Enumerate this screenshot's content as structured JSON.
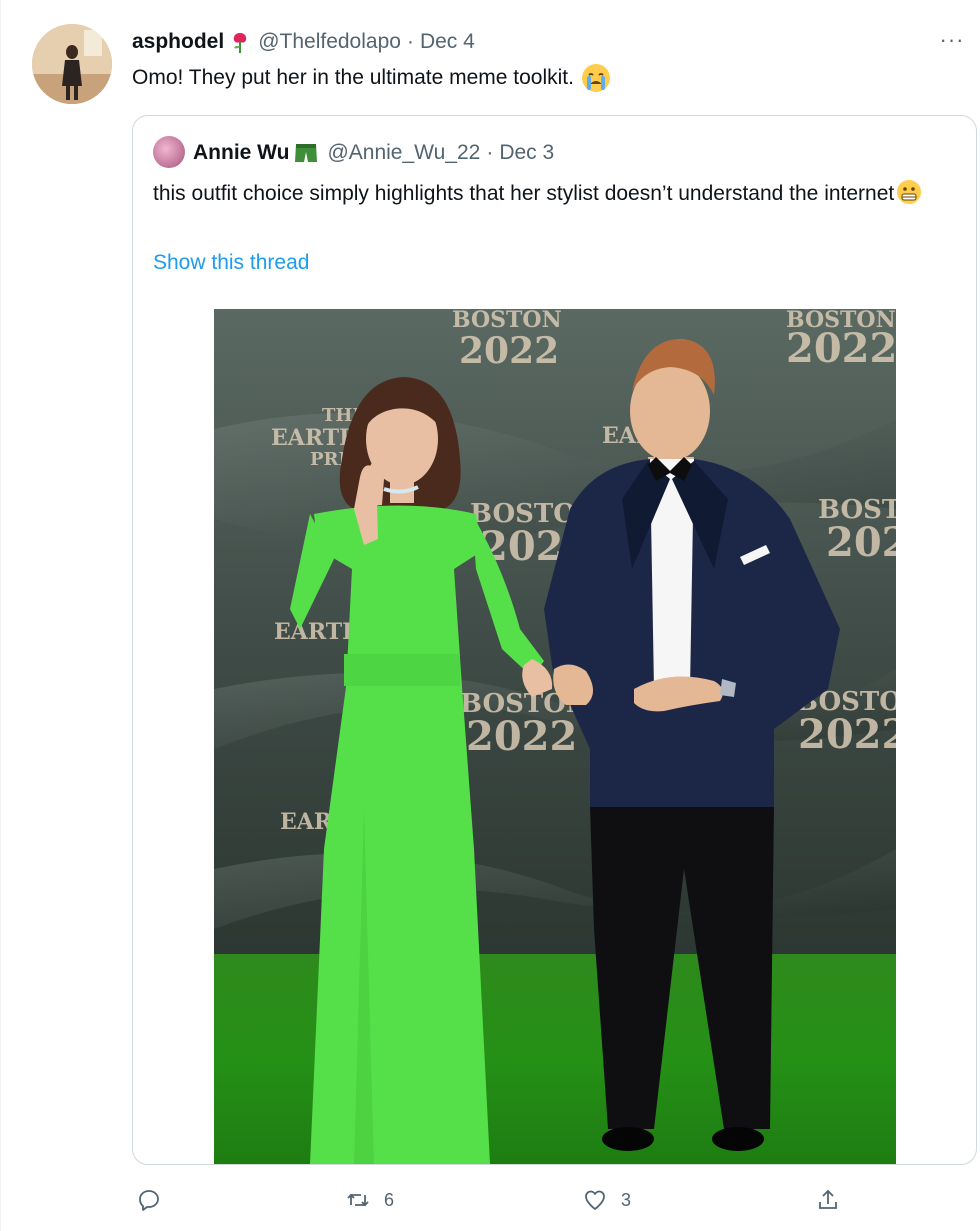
{
  "tweet": {
    "display_name": "asphodel",
    "handle": "@Thelfedolapo",
    "date": "Dec 4",
    "text": "Omo! They put her in the ultimate meme toolkit.",
    "more_label": "···"
  },
  "quoted": {
    "display_name": "Annie Wu",
    "handle": "@Annie_Wu_22",
    "date": "Dec 3",
    "text": "this outfit choice simply highlights that her stylist doesn’t understand the internet",
    "show_thread": "Show this thread"
  },
  "photo": {
    "backdrop": {
      "city": "BOSTON",
      "year": "2022",
      "earth": "EARTH",
      "the": "THE",
      "prize": "PRIZE"
    }
  },
  "actions": {
    "retweets": "6",
    "likes": "3"
  },
  "colors": {
    "link": "#1d9bf0",
    "muted": "#536471",
    "border": "#cfd9de",
    "dress_green": "#55e04a",
    "carpet_green": "#259016"
  }
}
